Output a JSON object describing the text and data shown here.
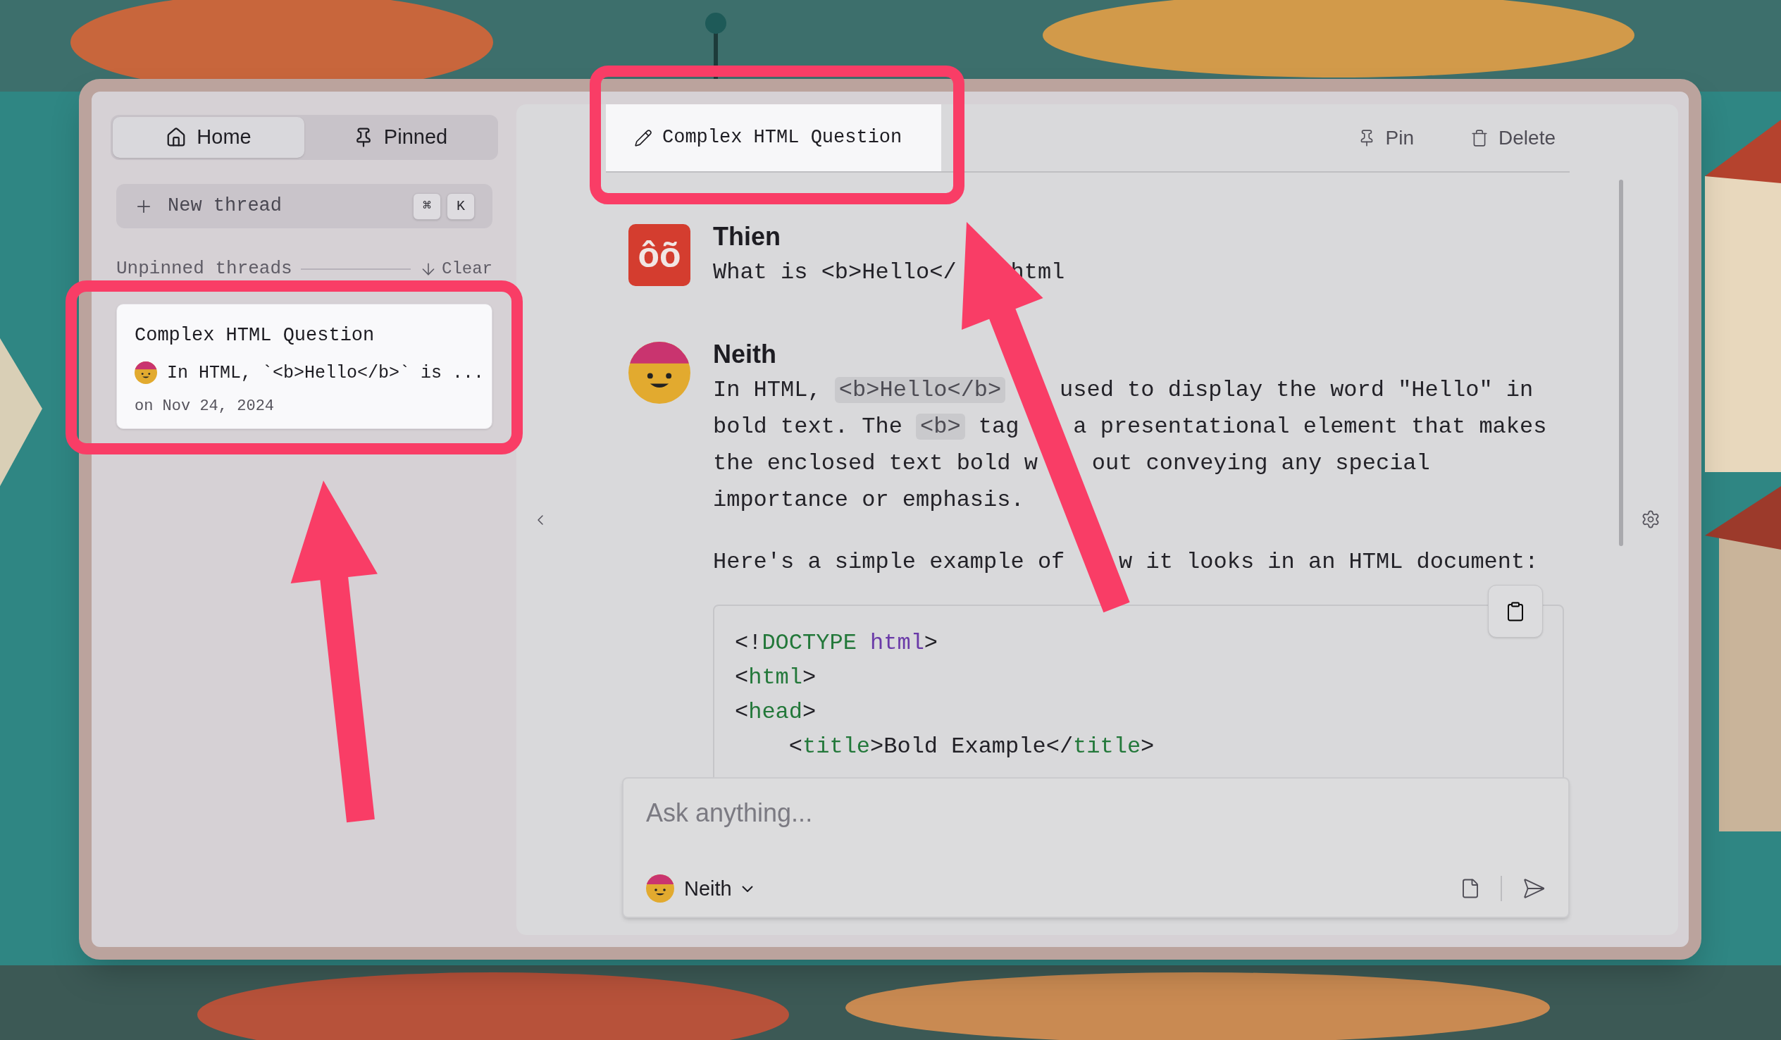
{
  "sidebar": {
    "tabs": [
      {
        "label": "Home",
        "selected": true
      },
      {
        "label": "Pinned",
        "selected": false
      }
    ],
    "new_thread": {
      "label": "New thread",
      "shortcut": [
        "⌘",
        "K"
      ]
    },
    "section": {
      "title": "Unpinned threads",
      "action": "Clear"
    },
    "threads": [
      {
        "title": "Complex HTML Question",
        "preview": "In HTML, `<b>Hello</b>` is ...",
        "date": "on Nov 24, 2024",
        "selected": true
      }
    ]
  },
  "thread": {
    "title": "Complex HTML Question",
    "actions": [
      "Pin",
      "Delete"
    ]
  },
  "messages": [
    {
      "author": "Thien",
      "kind": "user",
      "avatar_text": "ôõ",
      "paragraphs": [
        [
          [
            {
              "text": "What is <b>Hello</",
              "kind": "text"
            },
            {
              "text": "html",
              "kind": "text",
              "after_cover": true
            }
          ]
        ]
      ]
    },
    {
      "author": "Neith",
      "kind": "assistant",
      "paragraphs": [
        [
          [
            {
              "text": "In HTML, ",
              "kind": "text"
            },
            {
              "text": "<b>Hello</b>",
              "kind": "code"
            },
            {
              "text": "used to display the word \"Hello\" in",
              "kind": "text",
              "after_cover": true
            }
          ],
          [
            {
              "text": "bold text. The ",
              "kind": "text"
            },
            {
              "text": "<b>",
              "kind": "code"
            },
            {
              "text": " tag",
              "kind": "text"
            },
            {
              "text": "a presentational element that makes",
              "kind": "text",
              "after_cover": true
            }
          ],
          [
            {
              "text": "the enclosed text bold w",
              "kind": "text"
            },
            {
              "text": "out conveying any special",
              "kind": "text",
              "after_cover": true
            }
          ],
          [
            {
              "text": "importance or emphasis.",
              "kind": "text"
            }
          ]
        ],
        [
          [
            {
              "text": "Here's a simple example of",
              "kind": "text"
            },
            {
              "text": "w it looks in an HTML document:",
              "kind": "text",
              "after_cover": true
            }
          ]
        ]
      ],
      "code_block": [
        [
          {
            "text": "<!",
            "kind": "punct"
          },
          {
            "text": "DOCTYPE",
            "kind": "tag"
          },
          {
            "text": " html",
            "kind": "attr"
          },
          {
            "text": ">",
            "kind": "punct"
          }
        ],
        [
          {
            "text": "<",
            "kind": "punct"
          },
          {
            "text": "html",
            "kind": "tag"
          },
          {
            "text": ">",
            "kind": "punct"
          }
        ],
        [
          {
            "text": "<",
            "kind": "punct"
          },
          {
            "text": "head",
            "kind": "tag"
          },
          {
            "text": ">",
            "kind": "punct"
          }
        ],
        [
          {
            "text": "    <",
            "kind": "punct"
          },
          {
            "text": "title",
            "kind": "tag"
          },
          {
            "text": ">Bold Example</",
            "kind": "punct"
          },
          {
            "text": "title",
            "kind": "tag"
          },
          {
            "text": ">",
            "kind": "punct"
          }
        ]
      ]
    }
  ],
  "composer": {
    "placeholder": "Ask anything...",
    "assistant": "Neith"
  }
}
